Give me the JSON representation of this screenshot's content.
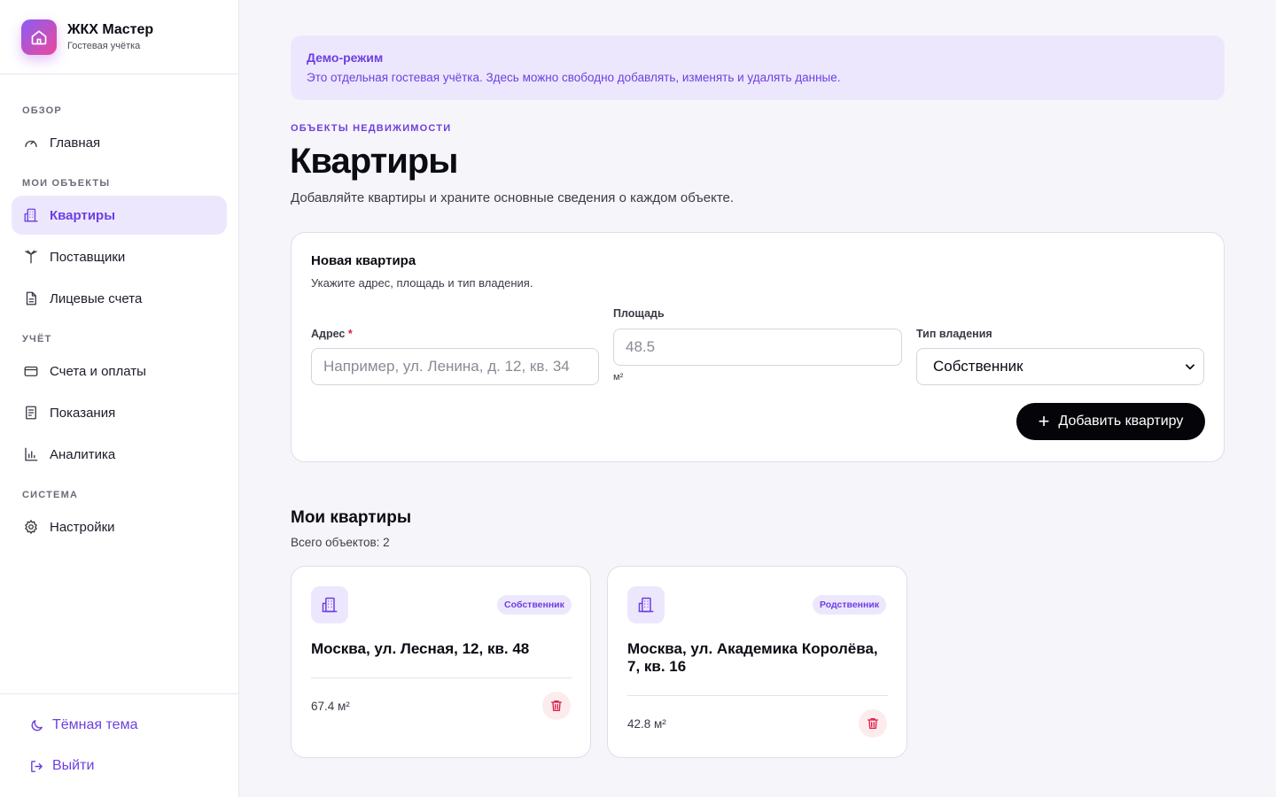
{
  "brand": {
    "title": "ЖКХ Мастер",
    "subtitle": "Гостевая учётка"
  },
  "sidebar": {
    "sections": [
      {
        "label": "ОБЗОР"
      },
      {
        "label": "МОИ ОБЪЕКТЫ"
      },
      {
        "label": "УЧЁТ"
      },
      {
        "label": "СИСТЕМА"
      }
    ],
    "items": [
      {
        "label": "Главная",
        "icon": "gauge-icon"
      },
      {
        "label": "Квартиры",
        "icon": "building-icon",
        "active": true
      },
      {
        "label": "Поставщики",
        "icon": "antenna-icon"
      },
      {
        "label": "Лицевые счета",
        "icon": "document-icon"
      },
      {
        "label": "Счета и оплаты",
        "icon": "credit-card-icon"
      },
      {
        "label": "Показания",
        "icon": "receipt-icon"
      },
      {
        "label": "Аналитика",
        "icon": "bar-chart-icon"
      },
      {
        "label": "Настройки",
        "icon": "gear-icon"
      }
    ],
    "footer": {
      "theme_label": "Тёмная тема",
      "logout_label": "Выйти"
    }
  },
  "demo_banner": {
    "title": "Демо-режим",
    "text": "Это отдельная гостевая учётка. Здесь можно свободно добавлять, изменять и удалять данные."
  },
  "page": {
    "eyebrow": "ОБЪЕКТЫ НЕДВИЖИМОСТИ",
    "title": "Квартиры",
    "subtitle": "Добавляйте квартиры и храните основные сведения о каждом объекте."
  },
  "form": {
    "title": "Новая квартира",
    "subtitle": "Укажите адрес, площадь и тип владения.",
    "address_label": "Адрес",
    "address_required_mark": "*",
    "address_placeholder": "Например, ул. Ленина, д. 12, кв. 34",
    "area_label": "Площадь",
    "area_placeholder": "48.5",
    "area_unit": "м²",
    "ownership_label": "Тип владения",
    "ownership_value": "Собственник",
    "submit_label": "Добавить квартиру"
  },
  "list": {
    "title": "Мои квартиры",
    "count_text": "Всего объектов: 2",
    "apartments": [
      {
        "address": "Москва, ул. Лесная, 12, кв. 48",
        "badge": "Собственник",
        "area": "67.4 м²"
      },
      {
        "address": "Москва, ул. Академика Королёва, 7, кв. 16",
        "badge": "Родственник",
        "area": "42.8 м²"
      }
    ]
  },
  "colors": {
    "accent": "#6d3fe0",
    "accent_bg": "#ede7fe",
    "danger": "#e11d48"
  }
}
